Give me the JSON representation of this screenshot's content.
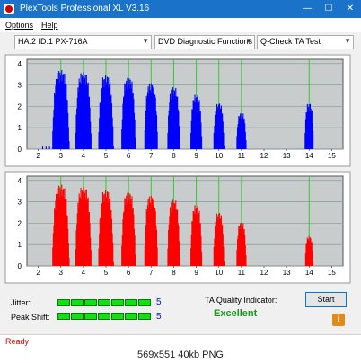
{
  "window": {
    "title": "PlexTools Professional XL V3.16",
    "min": "—",
    "max": "☐",
    "close": "✕"
  },
  "menu": [
    {
      "label": "Options"
    },
    {
      "label": "Help"
    }
  ],
  "toolbar": {
    "drive": "HA:2 ID:1  PX-716A",
    "function": "DVD Diagnostic Functions",
    "test": "Q-Check TA Test"
  },
  "colors": {
    "chart_bg": "#c8cccc",
    "top_series": "#0000ff",
    "bottom_series": "#ff0000",
    "marker_line": "#33cc33"
  },
  "chart_data": [
    {
      "type": "area",
      "y_ticks": [
        "4",
        "3",
        "2",
        "1",
        "0"
      ],
      "x_ticks": [
        "2",
        "3",
        "4",
        "5",
        "6",
        "7",
        "8",
        "9",
        "10",
        "11",
        "12",
        "13",
        "14",
        "15"
      ],
      "xlim": [
        1.5,
        15.5
      ],
      "ylim": [
        0,
        4.2
      ],
      "markers": [
        3,
        4,
        5,
        6,
        7,
        8,
        9,
        10,
        11,
        14
      ],
      "peaks": [
        {
          "x": 3.0,
          "y": 3.7,
          "w": 0.38
        },
        {
          "x": 4.0,
          "y": 3.6,
          "w": 0.36
        },
        {
          "x": 5.0,
          "y": 3.45,
          "w": 0.34
        },
        {
          "x": 6.0,
          "y": 3.35,
          "w": 0.32
        },
        {
          "x": 7.0,
          "y": 3.1,
          "w": 0.3
        },
        {
          "x": 8.0,
          "y": 2.9,
          "w": 0.28
        },
        {
          "x": 9.0,
          "y": 2.55,
          "w": 0.26
        },
        {
          "x": 10.0,
          "y": 2.15,
          "w": 0.24
        },
        {
          "x": 11.0,
          "y": 1.7,
          "w": 0.22
        },
        {
          "x": 14.0,
          "y": 2.15,
          "w": 0.2
        }
      ],
      "noise": [
        2.2,
        2.35,
        2.5,
        2.65,
        2.72
      ]
    },
    {
      "type": "area",
      "y_ticks": [
        "4",
        "3",
        "2",
        "1",
        "0"
      ],
      "x_ticks": [
        "2",
        "3",
        "4",
        "5",
        "6",
        "7",
        "8",
        "9",
        "10",
        "11",
        "12",
        "13",
        "14",
        "15"
      ],
      "xlim": [
        1.5,
        15.5
      ],
      "ylim": [
        0,
        4.2
      ],
      "markers": [
        3,
        4,
        5,
        6,
        7,
        8,
        9,
        10,
        11,
        14
      ],
      "peaks": [
        {
          "x": 3.0,
          "y": 3.8,
          "w": 0.38
        },
        {
          "x": 4.0,
          "y": 3.7,
          "w": 0.36
        },
        {
          "x": 5.0,
          "y": 3.55,
          "w": 0.34
        },
        {
          "x": 6.0,
          "y": 3.45,
          "w": 0.32
        },
        {
          "x": 7.0,
          "y": 3.3,
          "w": 0.3
        },
        {
          "x": 8.0,
          "y": 3.1,
          "w": 0.28
        },
        {
          "x": 9.0,
          "y": 2.85,
          "w": 0.26
        },
        {
          "x": 10.0,
          "y": 2.5,
          "w": 0.24
        },
        {
          "x": 11.0,
          "y": 2.05,
          "w": 0.22
        },
        {
          "x": 14.0,
          "y": 1.4,
          "w": 0.18
        }
      ],
      "noise": []
    }
  ],
  "stats": {
    "jitter_label": "Jitter:",
    "jitter_value": "5",
    "peak_label": "Peak Shift:",
    "peak_value": "5",
    "ta_label": "TA Quality Indicator:",
    "ta_value": "Excellent"
  },
  "buttons": {
    "start": "Start",
    "info": "i"
  },
  "status": "Ready",
  "caption": "569x551  40kb  PNG"
}
